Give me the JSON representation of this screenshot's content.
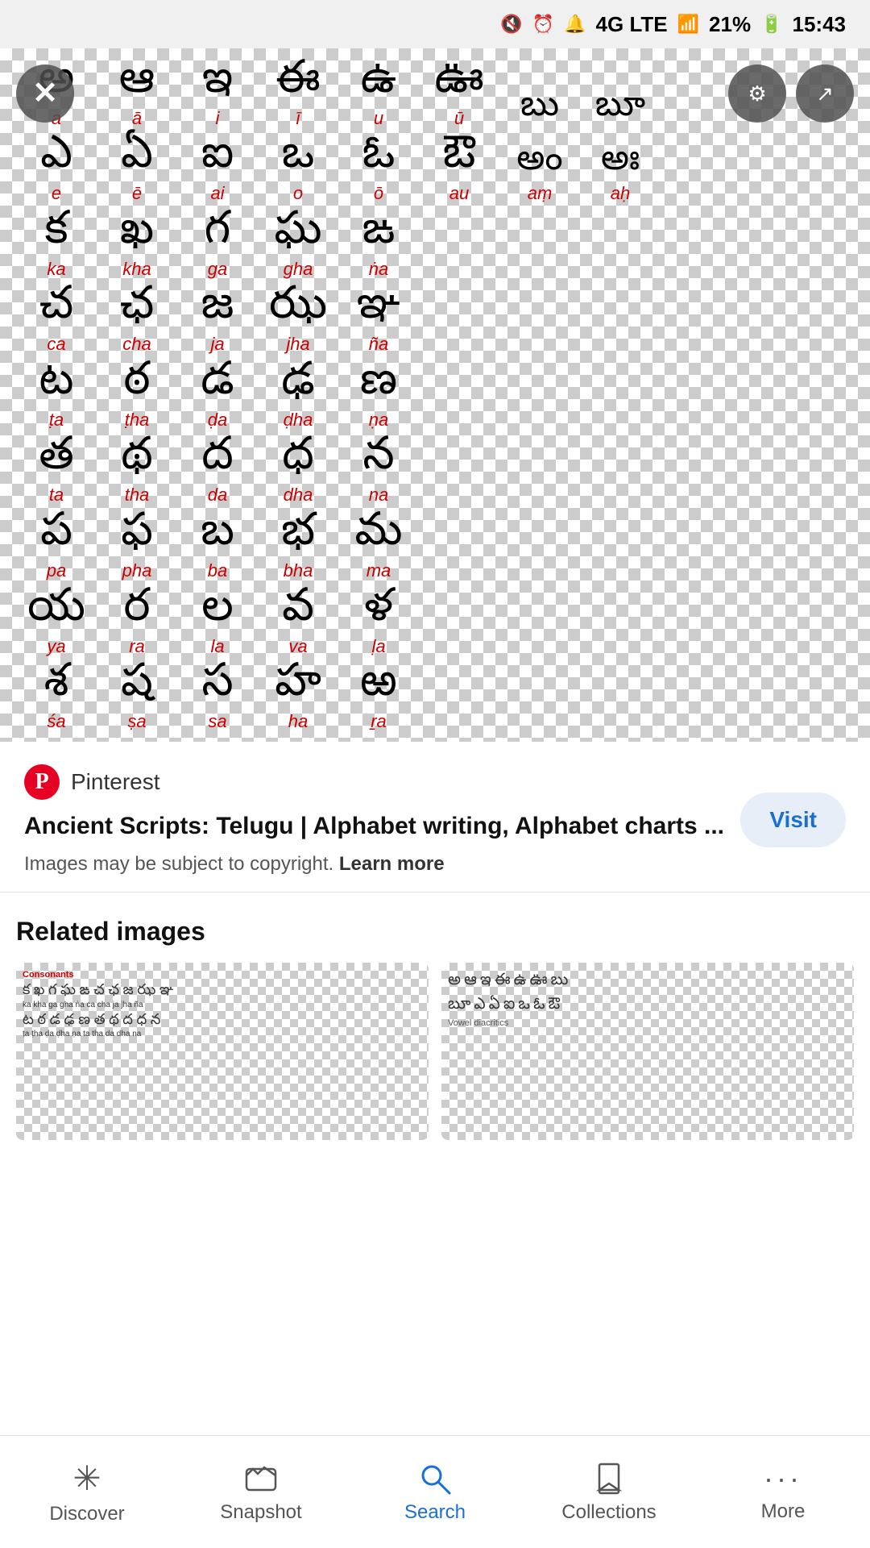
{
  "statusBar": {
    "mute": "🔇",
    "alarm": "⏰",
    "volume": "🔔",
    "network": "4G LTE",
    "signal": "▲",
    "battery": "21%",
    "time": "15:43"
  },
  "image": {
    "altText": "Telugu alphabet chart"
  },
  "rows": [
    [
      {
        "char": "అ",
        "label": "a"
      },
      {
        "char": "ఆ",
        "label": "ā"
      },
      {
        "char": "ఇ",
        "label": "i"
      },
      {
        "char": "ఈ",
        "label": "ī"
      },
      {
        "char": "ఉ",
        "label": "u"
      },
      {
        "char": "ఊ",
        "label": "ū"
      },
      {
        "char": "బు",
        "label": ""
      },
      {
        "char": "బూ",
        "label": ""
      }
    ],
    [
      {
        "char": "ఎ",
        "label": "e"
      },
      {
        "char": "ఏ",
        "label": "ē"
      },
      {
        "char": "ఐ",
        "label": "ai"
      },
      {
        "char": "ఒ",
        "label": "o"
      },
      {
        "char": "ఓ",
        "label": "ō"
      },
      {
        "char": "ఔ",
        "label": "au"
      },
      {
        "char": "అం",
        "label": "aṃ"
      },
      {
        "char": "అః",
        "label": "aḥ"
      }
    ],
    [
      {
        "char": "క",
        "label": "ka"
      },
      {
        "char": "ఖ",
        "label": "kha"
      },
      {
        "char": "గ",
        "label": "ga"
      },
      {
        "char": "ఘ",
        "label": "gha"
      },
      {
        "char": "ఙ",
        "label": "ṅa"
      },
      {
        "char": "",
        "label": ""
      },
      {
        "char": "",
        "label": ""
      },
      {
        "char": "",
        "label": ""
      }
    ],
    [
      {
        "char": "చ",
        "label": "ca"
      },
      {
        "char": "ఛ",
        "label": "cha"
      },
      {
        "char": "జ",
        "label": "ja"
      },
      {
        "char": "ఝ",
        "label": "jha"
      },
      {
        "char": "ఞ",
        "label": "ña"
      },
      {
        "char": "",
        "label": ""
      },
      {
        "char": "",
        "label": ""
      },
      {
        "char": "",
        "label": ""
      }
    ],
    [
      {
        "char": "ట",
        "label": "ṭa"
      },
      {
        "char": "ఠ",
        "label": "ṭha"
      },
      {
        "char": "డ",
        "label": "ḍa"
      },
      {
        "char": "ఢ",
        "label": "ḍha"
      },
      {
        "char": "ణ",
        "label": "ṇa"
      },
      {
        "char": "",
        "label": ""
      },
      {
        "char": "",
        "label": ""
      },
      {
        "char": "",
        "label": ""
      }
    ],
    [
      {
        "char": "త",
        "label": "ta"
      },
      {
        "char": "థ",
        "label": "tha"
      },
      {
        "char": "ద",
        "label": "da"
      },
      {
        "char": "ధ",
        "label": "dha"
      },
      {
        "char": "న",
        "label": "na"
      },
      {
        "char": "",
        "label": ""
      },
      {
        "char": "",
        "label": ""
      },
      {
        "char": "",
        "label": ""
      }
    ],
    [
      {
        "char": "ప",
        "label": "pa"
      },
      {
        "char": "ఫ",
        "label": "pha"
      },
      {
        "char": "బ",
        "label": "ba"
      },
      {
        "char": "భ",
        "label": "bha"
      },
      {
        "char": "మ",
        "label": "ma"
      },
      {
        "char": "",
        "label": ""
      },
      {
        "char": "",
        "label": ""
      },
      {
        "char": "",
        "label": ""
      }
    ],
    [
      {
        "char": "య",
        "label": "ya"
      },
      {
        "char": "ర",
        "label": "ra"
      },
      {
        "char": "ల",
        "label": "la"
      },
      {
        "char": "వ",
        "label": "va"
      },
      {
        "char": "ళ",
        "label": "ḷa"
      },
      {
        "char": "",
        "label": ""
      },
      {
        "char": "",
        "label": ""
      },
      {
        "char": "",
        "label": ""
      }
    ],
    [
      {
        "char": "శ",
        "label": "śa"
      },
      {
        "char": "ష",
        "label": "ṣa"
      },
      {
        "char": "స",
        "label": "sa"
      },
      {
        "char": "హ",
        "label": "ha"
      },
      {
        "char": "ఱ",
        "label": "ṟa"
      },
      {
        "char": "",
        "label": ""
      },
      {
        "char": "",
        "label": ""
      },
      {
        "char": "",
        "label": ""
      }
    ]
  ],
  "sourceCard": {
    "logoLetter": "P",
    "sourceName": "Pinterest",
    "title": "Ancient Scripts: Telugu | Alphabet writing, Alphabet charts ...",
    "copyrightText": "Images may be subject to copyright.",
    "learnMoreLabel": "Learn more",
    "visitLabel": "Visit"
  },
  "relatedSection": {
    "title": "Related images"
  },
  "bottomNav": {
    "items": [
      {
        "label": "Discover",
        "icon": "✳",
        "active": false,
        "name": "discover"
      },
      {
        "label": "Snapshot",
        "icon": "⬛",
        "active": false,
        "name": "snapshot"
      },
      {
        "label": "Search",
        "icon": "🔍",
        "active": true,
        "name": "search"
      },
      {
        "label": "Collections",
        "icon": "🔖",
        "active": false,
        "name": "collections"
      },
      {
        "label": "More",
        "icon": "···",
        "active": false,
        "name": "more"
      }
    ]
  }
}
